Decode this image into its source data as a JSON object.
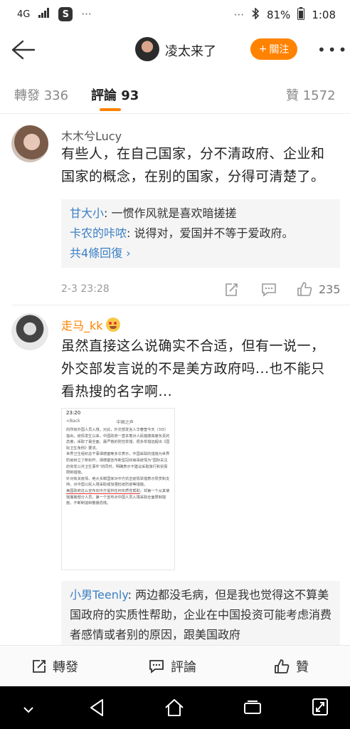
{
  "status_bar": {
    "network": "4G",
    "notification": "S",
    "dots": "···",
    "more_dots": "···",
    "battery": "81%",
    "time": "1:08"
  },
  "header": {
    "user_name": "凌太来了",
    "follow_label": "關注"
  },
  "tabs": {
    "repost": "轉發 336",
    "comments": "評論 93",
    "likes": "贊 1572"
  },
  "comments": [
    {
      "user": "木木兮Lucy",
      "text_line1": "有些人，在自己国家，分不清政府、企业和",
      "text_line2": "国家的概念，在别的国家，分得可清楚了。",
      "replies": [
        {
          "user": "甘大小",
          "text": ": 一惯作风就是喜欢暗搓搓"
        },
        {
          "user": "卡农的咔哝",
          "text": ": 说得对，爱国并不等于爱政府。"
        }
      ],
      "more_replies": "共4條回復 ›",
      "timestamp": "2-3 23:28",
      "like_count": "235"
    },
    {
      "user": "走马_kk",
      "text_line1": "虽然直接这么说确实不合适，但有一说一，",
      "text_line2": "外交部发言说的不是美方政府吗...也不能只",
      "text_line3": "看热搜的名字啊...",
      "screenshot": {
        "time": "23:20",
        "back": "<Back",
        "source": "中国之声",
        "body1": "的所有外国人员入境。对此，外交部发言人华春莹今天（3日）指出，疫情发生以来，中国政府一直本着对人民健康高度负责的态度，采取了最全面、最严格的防控举措，很多举措远超出《国际卫生条例》要求。",
        "body2": "世界卫生组织总干事谭德塞等多次表示，中国采取的措施为世界防疫树立了新标杆。谭德塞宣布新型冠状病毒疫情为\"国际关注的突发公共卫生事件\"的同时，明确表示不建议采取旅行和贸易限制措施。",
        "body3": "针对有关疫情，绝大多数国家对中方抗击疫情举措表示赞赏和支持，对中国公民入境采取或加强检疫防疫等措施。",
        "body_highlight": "美国政府这么宣布向中方提供任何实质性帮助",
        "body4": "，却第一个从其使馆撤离部分人员，第一个宣布对中国人员入境采取全面限制措施，不断制造和散播恐慌。"
      },
      "replies": [
        {
          "user": "小男Teenly",
          "text": ": 两边都没毛病，但是我也觉得这不算美国政府的实质性帮助，企业在中国投资可能考虑消费者感情或者别的原因，跟美国政府"
        }
      ]
    }
  ],
  "actions": {
    "repost": "轉發",
    "comment": "評論",
    "like": "贊"
  },
  "colors": {
    "accent": "#ff8200",
    "link": "#3b7fc4",
    "vip_name": "#ff8200"
  }
}
